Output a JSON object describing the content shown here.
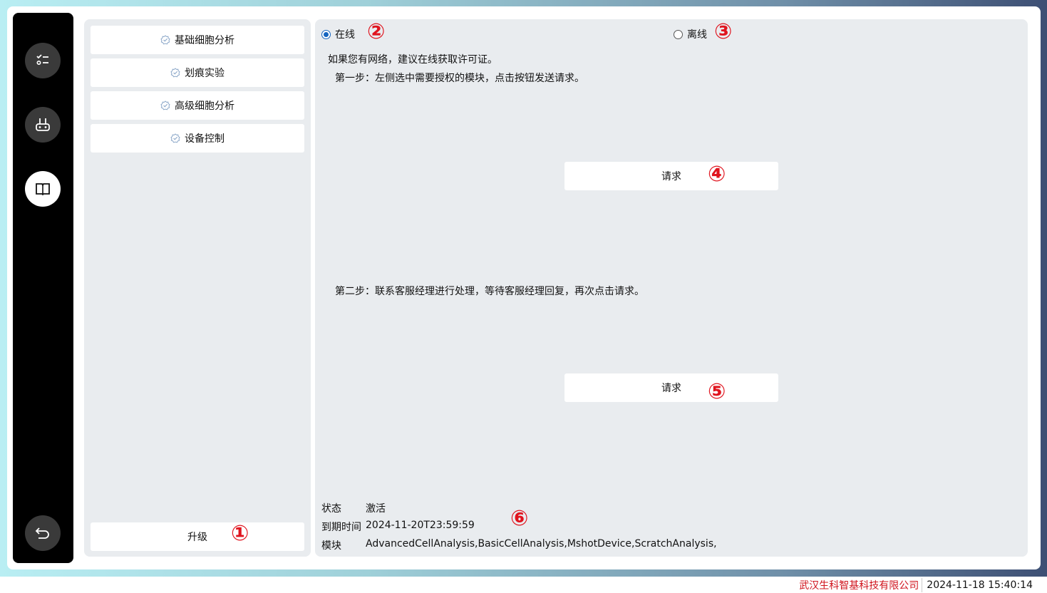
{
  "sidebar": {
    "buttons": [
      {
        "icon": "checklist-icon"
      },
      {
        "icon": "robot-icon"
      },
      {
        "icon": "book-icon",
        "active": true
      },
      {
        "icon": "back-icon"
      }
    ]
  },
  "modules": {
    "items": [
      {
        "label": "基础细胞分析",
        "icon": "badge-check-icon"
      },
      {
        "label": "划痕实验",
        "icon": "badge-check-icon"
      },
      {
        "label": "高级细胞分析",
        "icon": "badge-check-icon"
      },
      {
        "label": "设备控制",
        "icon": "badge-check-icon"
      }
    ],
    "upgrade_label": "升级"
  },
  "license": {
    "online_label": "在线",
    "offline_label": "离线",
    "selected": "online",
    "intro": "如果您有网络，建议在线获取许可证。",
    "step1": "第一步：左侧选中需要授权的模块，点击按钮发送请求。",
    "request1_label": "请求",
    "step2": "第二步：联系客服经理进行处理，等待客服经理回复，再次点击请求。",
    "request2_label": "请求",
    "status_key": "状态",
    "status_value": "激活",
    "expiry_key": "到期时间",
    "expiry_value": "2024-11-20T23:59:59",
    "modules_key": "模块",
    "modules_value": "AdvancedCellAnalysis,BasicCellAnalysis,MshotDevice,ScratchAnalysis,"
  },
  "markers": {
    "m1": "①",
    "m2": "②",
    "m3": "③",
    "m4": "④",
    "m5": "⑤",
    "m6": "⑥"
  },
  "footer": {
    "company": "武汉生科智基科技有限公司",
    "datetime": "2024-11-18 15:40:14"
  },
  "colors": {
    "accent": "#1565c0",
    "marker": "#e0141e",
    "company": "#d0141e",
    "panel": "#e9ecef"
  }
}
